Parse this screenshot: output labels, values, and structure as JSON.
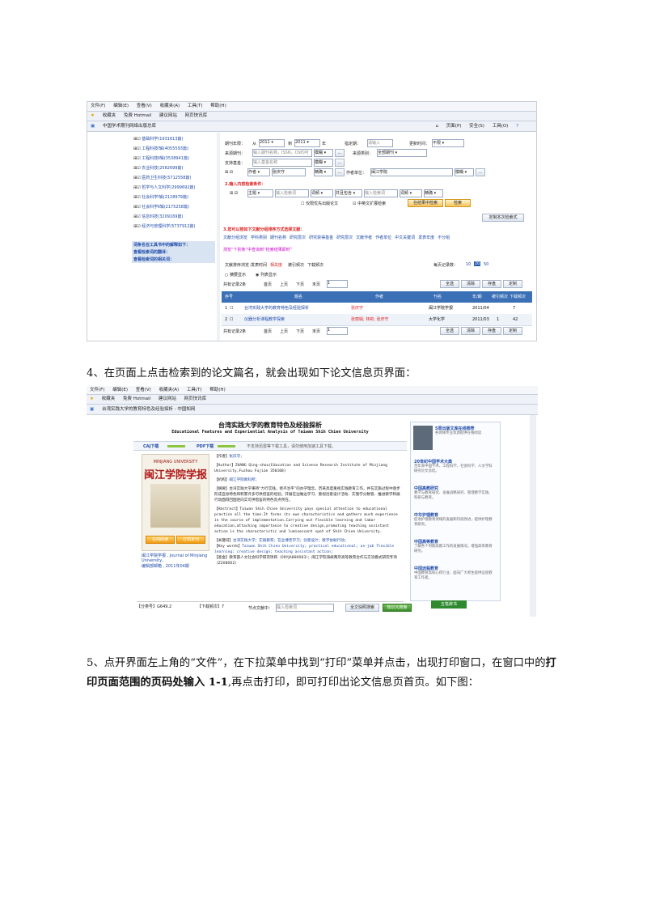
{
  "shot1": {
    "menu": [
      "文件(F)",
      "编辑(E)",
      "查看(V)",
      "收藏夹(A)",
      "工具(T)",
      "帮助(H)"
    ],
    "favorites": [
      "收藏夹",
      "免费 Hotmail",
      "建议网站",
      "网页快讯库"
    ],
    "tab_title": "中国学术期刊网络出版总库",
    "ie_tools": [
      "页面(P)",
      "安全(S)",
      "工具(O)"
    ],
    "sidebar": [
      "基础科学(1931613篇)",
      "工程科技Ⅰ辑(4055593篇)",
      "工程科技Ⅱ辑(3538941篇)",
      "农业科技(2582699篇)",
      "医药卫生科技(5712558篇)",
      "哲学与人文科学(2999692篇)",
      "社会科学Ⅰ辑(2128979篇)",
      "社会科学Ⅱ辑(2175258篇)",
      "信息科技(3209169篇)",
      "经济与管理科学(5737912篇)"
    ],
    "sidebar_links": [
      "词条名在工具书中的解释如下：",
      "查看检索词的翻译：",
      "查看检索词的相关词："
    ],
    "form": {
      "year_label": "期刊年限：",
      "from": "从",
      "year_from": "2011",
      "to": "到",
      "year_to": "2011",
      "year_unit": "年",
      "date_label": "指定期：",
      "date_value": "请输入",
      "update_label": "更新时间：",
      "update_value": "不限",
      "source_label": "来源期刊：",
      "source_placeholder": "输入期刊名称，ISSN，CN均可",
      "fuzzy": "模糊",
      "category_label": "来源类别：",
      "category_value": "全部期刊",
      "fund_label": "支持基金：",
      "fund_placeholder": "输入基金名称",
      "author_field": "作者",
      "author_value": "张庆守",
      "precise": "精确",
      "org_label": "作者单位：",
      "org_value": "闽江学院",
      "step2": "2.输入内容检索条件：",
      "subject": "主题",
      "kw_placeholder": "输入检索词",
      "word_freq": "词频",
      "and": "并且包含",
      "expand1": "在结果中检索",
      "expand2": "检索",
      "exact_match": "中英文扩展检索",
      "exclude": "仅限优先出版论文",
      "define": "定制本次检索式",
      "step3": "3.您可以按如下文献分组排序方式选择文献：",
      "groups": [
        "文献分组浏览",
        "学科类别",
        "期刊名称",
        "研究层次",
        "研究获得基金",
        "研究层次",
        "文献作者",
        "作者单位",
        "中文关键词",
        "发表年度",
        "不分组"
      ],
      "hint": "测览“个别条”中查询到“检索结果即时”",
      "sort_label": "文献排序浏览：",
      "sorts": [
        "发表时间",
        "相关度",
        "被引频次",
        "下载频次"
      ],
      "per_page": "每页记录数：",
      "per_page_opts": [
        "10",
        "20",
        "50"
      ],
      "view_opts": [
        "摘要显示",
        "列表显示"
      ],
      "record_count": "共有记录2条",
      "pager": [
        "首页",
        "上页",
        "下页",
        "末页"
      ],
      "page_input": "1",
      "actions": [
        "全选",
        "清除",
        "存盘",
        "定制"
      ]
    },
    "table": {
      "headers": [
        "序号",
        "题名",
        "作者",
        "刊名",
        "年/期",
        "被引频次",
        "下载频次"
      ],
      "rows": [
        {
          "no": "1",
          "title": "台湾实践大学的教育特色及经验探析",
          "author": "张庆守",
          "journal": "闽江学院学报",
          "issue": "2011/04",
          "cited": "",
          "downloads": "7"
        },
        {
          "no": "2",
          "title": "仪器分析课程教学探索",
          "author": "张丽娟; 林莉; 张庆守",
          "journal": "大学化学",
          "issue": "2011/03",
          "cited": "1",
          "downloads": "42"
        }
      ]
    }
  },
  "para1": "4、在页面上点击检索到的论文篇名，就会出现如下论文信息页界面：",
  "shot2": {
    "menu": [
      "文件(F)",
      "编辑(E)",
      "查看(V)",
      "收藏夹(A)",
      "工具(T)",
      "帮助(H)"
    ],
    "favorites": [
      "收藏夹",
      "免费 Hotmail",
      "建议网站",
      "网页快讯库"
    ],
    "tab_title": "台湾实践大学的教育特色及经验探析 - 中国知网",
    "title_cn": "台湾实践大学的教育特色及经验探析",
    "title_en_1": "Educational Features and Experiential Analysis of Taiwan Shih Chien University",
    "download_caj": "CAJ下载",
    "download_pdf": "PDF下载",
    "download_hint": "不支持迅雷等下载工具，请勿使用加速工具下载。",
    "cover_top": "MINJIANG UNIVERSITY",
    "cover_title": "闽江学院学报",
    "cover_btn1": "在线阅读",
    "cover_btn2": "订阅本刊",
    "journal_info_1": "闽江学院学报 , Journal of Minjiang University,",
    "journal_info_2": "编辑部邮箱 , 2011年04期",
    "author_label": "【作者】",
    "author": "张庆守；",
    "author_en_label": "【Author】",
    "author_en": "ZHANG Qing-shou(Education and Science Research Institute of Minjiang University,Fuzhou Fujian 350108)",
    "org_label": "【机构】",
    "org": "闽江学院教科所；",
    "abstract_label": "【摘要】",
    "abstract": "台湾实践大学秉持“力行实践，修齐治平”的办学理念，历来高度重视实践教育工作，并在实施过程中逐步形成自身特色和积累许多可供借鉴的经验。开展在边做边学习、重视创意设计活动、实施学分数管、推进教学和展行动面得回国连向实可供借鉴的特色亮点所在。",
    "abstract_en_label": "【Abstract】",
    "abstract_en": "Taiwan Shih Chien University pays special attention to educational practice all the time.It forms its own characteristics and gathers much experience in the course of implementation.Carrying out flexible learning and labor education,attaching importance to creative design,promoting teaching assistant action is the characteristic and luminescent spot of Shih Chien University.",
    "keywords_label": "【关键词】",
    "keywords": "台湾实践大学；实践教育；在业博佳学习；创意设计；教学协助行动；",
    "keywords_en_label": "【Key words】",
    "keywords_en": "Taiwan Shih Chien University; practical educational; on-job flexible learning; creative design; teaching assistant action;",
    "fund_label": "【基金】",
    "fund": "教育部人文社会科学研究项目（09YJA880063）；闽江学院海峡两岸高等教育合作与交流模式研究专项（Z208002）",
    "class_label": "【分类号】",
    "class": "G649.2",
    "download_freq": "【下载频次】",
    "download_freq_value": "7",
    "side_links": [
      {
        "title": "5周出版文库在线推荐",
        "desc": "各领域专业资源提供在线阅读"
      },
      {
        "title": "20世纪中国学术大典",
        "desc": "百年来中国学术，工程科学、社会科学、人文学科研究论文总结。"
      },
      {
        "title": "中国高教研究",
        "desc": "教学与教育研究、发展战略研究、管理教学实践、科研与教育。"
      },
      {
        "title": "中华护理教育",
        "desc": "促进护理教育领域的发展和持续改进，提供护理教育研究。"
      },
      {
        "title": "中国高等教育",
        "desc": "了解各个时期高教工作的发展情况，增强高等教育研究。"
      },
      {
        "title": "中国远程教育",
        "desc": "中国教育高校心得行业、面向广大师生提供远程教育工作者。"
      }
    ],
    "search_label": "节点文献中：",
    "search_placeholder": "输入检索词",
    "search_btn1": "全文快照搜索",
    "search_btn2": "知识元搜索",
    "right_badge": "五笔辞书"
  },
  "para2": "5、点开界面左上角的“文件”，在下拉菜单中找到“打印”菜单并点击，出现打印窗口，在窗口中的打印页面范围的页码处输入1-1,再点击打印，即可打印出论文信息页首页。如下图：",
  "para2_parts": {
    "a": "5、点开界面左上角的“文件”，在下拉菜单中找到“打印”菜单并点击，出现打印窗口，在窗",
    "b": "口中的",
    "b_bold": "打印页面范围的页码处输入 1-1",
    "c": ",再点击打印，即可打印出论文信息页首页。如下图："
  }
}
